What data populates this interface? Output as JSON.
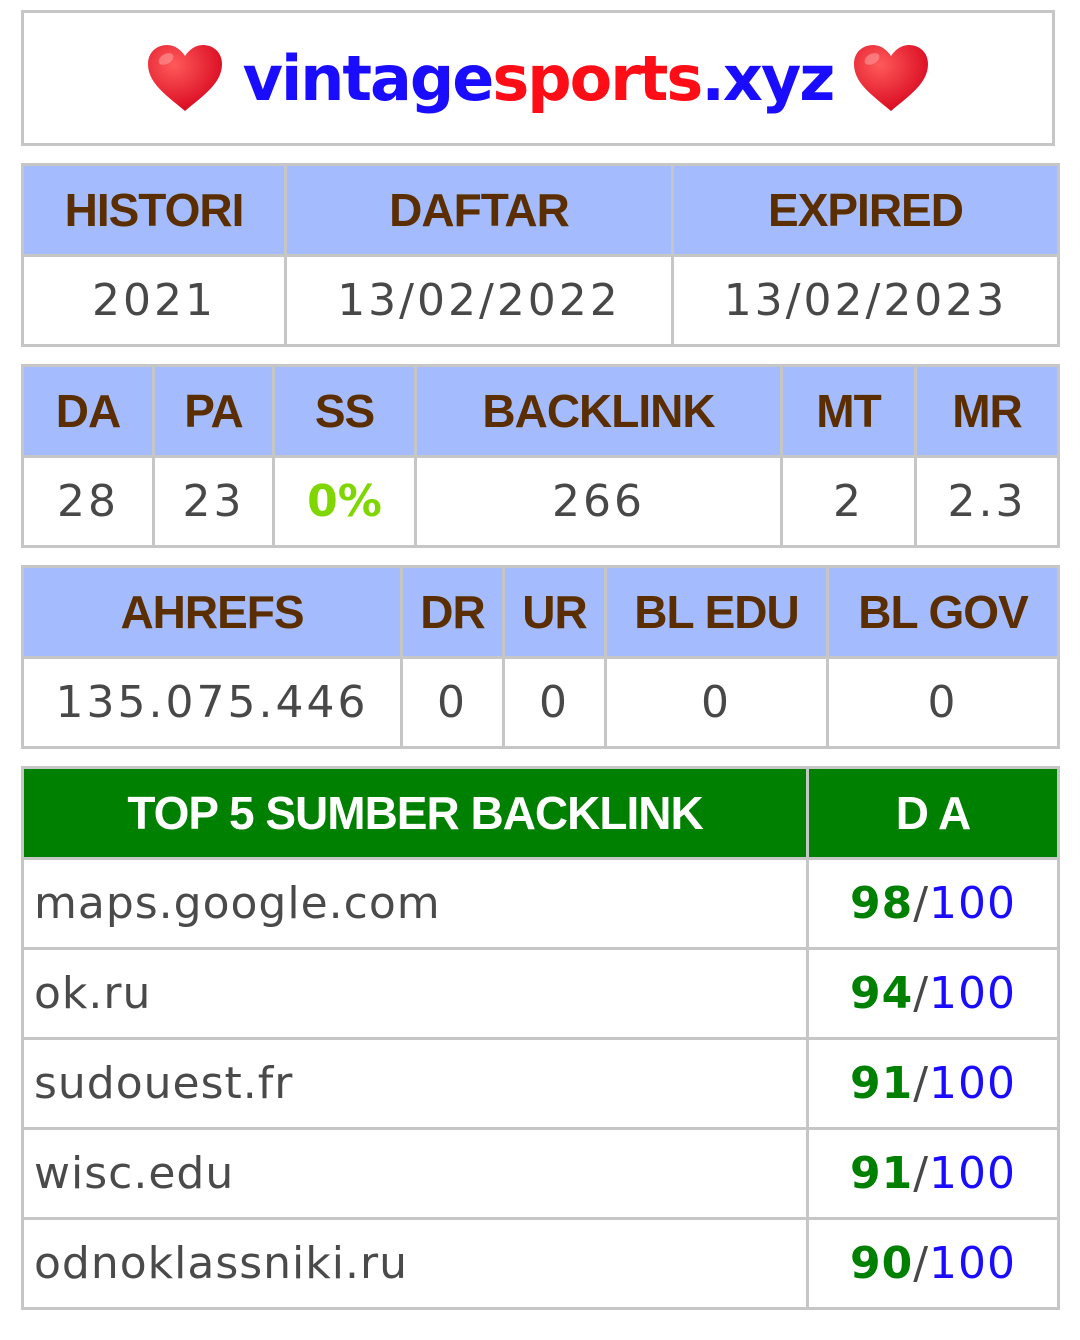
{
  "title": {
    "left_icon": "heart-icon",
    "part1": "vintage",
    "part2": "sports",
    "part3": ".xyz",
    "right_icon": "heart-icon"
  },
  "colors": {
    "header_bg": "#a4bcfe",
    "header_text": "#5a2e00",
    "green_header": "#008000",
    "title_blue": "#1a0dff",
    "title_red": "#ff0d16",
    "ss_green": "#7fd600"
  },
  "domain_info": {
    "headers": [
      "HISTORI",
      "DAFTAR",
      "EXPIRED"
    ],
    "values": [
      "2021",
      "13/02/2022",
      "13/02/2023"
    ]
  },
  "moz": {
    "headers": [
      "DA",
      "PA",
      "SS",
      "BACKLINK",
      "MT",
      "MR"
    ],
    "values": [
      "28",
      "23",
      "0%",
      "266",
      "2",
      "2.3"
    ]
  },
  "ahrefs": {
    "headers": [
      "AHREFS",
      "DR",
      "UR",
      "BL EDU",
      "BL GOV"
    ],
    "values": [
      "135.075.446",
      "0",
      "0",
      "0",
      "0"
    ]
  },
  "top_backlinks": {
    "header_source": "TOP 5 SUMBER BACKLINK",
    "header_da": "D A",
    "rows": [
      {
        "site": "maps.google.com",
        "da": "98",
        "slash": "/",
        "max": "100"
      },
      {
        "site": "ok.ru",
        "da": "94",
        "slash": "/",
        "max": "100"
      },
      {
        "site": "sudouest.fr",
        "da": "91",
        "slash": "/",
        "max": "100"
      },
      {
        "site": "wisc.edu",
        "da": "91",
        "slash": "/",
        "max": "100"
      },
      {
        "site": "odnoklassniki.ru",
        "da": "90",
        "slash": "/",
        "max": "100"
      }
    ]
  }
}
